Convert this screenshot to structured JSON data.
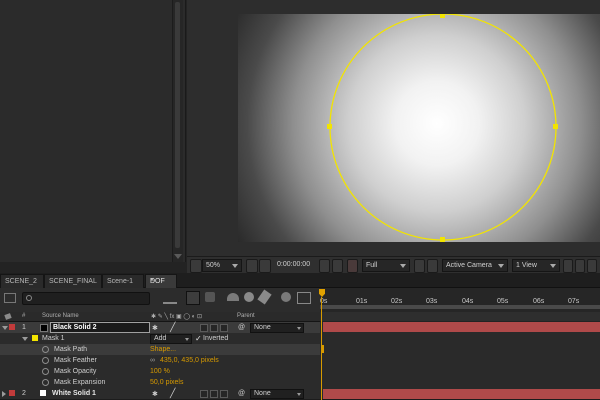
{
  "viewer_toolbar": {
    "zoom": "50%",
    "timecode": "0:00:00:00",
    "resolution": "Full",
    "camera": "Active Camera",
    "views": "1 View"
  },
  "tabs": [
    {
      "label": "SCENE_2",
      "active": false
    },
    {
      "label": "SCENE_FINAL",
      "active": false
    },
    {
      "label": "Scene-1",
      "active": false
    },
    {
      "label": "DOF",
      "active": true
    }
  ],
  "tab_close_glyph": "×",
  "timeline": {
    "search_placeholder": "",
    "columns": {
      "label_icon": "label-icon",
      "num": "#",
      "source_name": "Source Name",
      "parent": "Parent"
    },
    "ruler_start": "0s",
    "ruler_ticks": [
      "01s",
      "02s",
      "03s",
      "04s",
      "05s",
      "06s",
      "07s"
    ],
    "layers": [
      {
        "num": "1",
        "name": "Black Solid 2",
        "label_color": "#c23b3b",
        "swatch_color": "#000000",
        "parent": "None",
        "mask": {
          "name": "Mask 1",
          "color": "#f2e400",
          "mode": "Add",
          "inverted_label": "Inverted",
          "properties": [
            {
              "name": "Mask Path",
              "value": "Shape..."
            },
            {
              "name": "Mask Feather",
              "value": "435,0, 435,0 pixels"
            },
            {
              "name": "Mask Opacity",
              "value": "100 %"
            },
            {
              "name": "Mask Expansion",
              "value": "50,0 pixels"
            }
          ]
        }
      },
      {
        "num": "2",
        "name": "White Solid 1",
        "label_color": "#c23b3b",
        "swatch_color": "#ffffff",
        "parent": "None"
      }
    ]
  },
  "colors": {
    "accent": "#d79a00",
    "mask_outline": "#f2e400",
    "layer_bar": "#b04a4a"
  }
}
